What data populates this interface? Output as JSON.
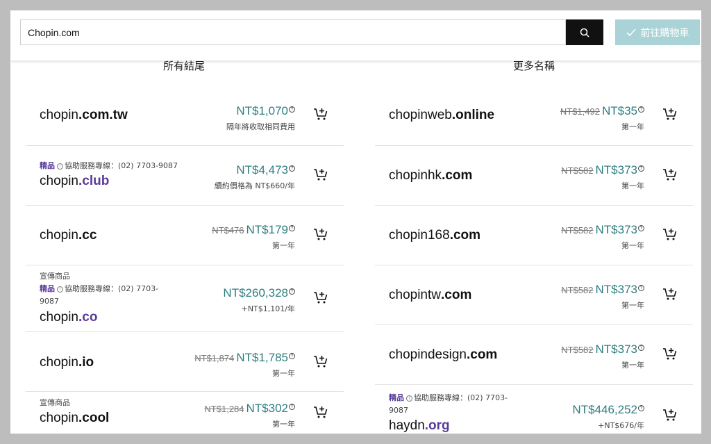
{
  "search": {
    "value": "Chopin.com"
  },
  "cart_button": {
    "label": "前往購物車"
  },
  "columns": {
    "left_title": "所有結尾",
    "right_title": "更多名稱"
  },
  "left": [
    {
      "sld": "chopin",
      "tld": ".com.tw",
      "tld_purple": false,
      "tags": [],
      "old": "",
      "price": "NT$1,070",
      "note": "隔年將收取相同費用"
    },
    {
      "sld": "chopin",
      "tld": ".club",
      "tld_purple": true,
      "promo": "",
      "premium": "精品",
      "service": "協助服務專線：(02) 7703-9087",
      "old": "",
      "price": "NT$4,473",
      "note": "續約價格為 NT$660/年"
    },
    {
      "sld": "chopin",
      "tld": ".cc",
      "tld_purple": false,
      "old": "NT$476",
      "price": "NT$179",
      "note": "第一年"
    },
    {
      "sld": "chopin",
      "tld": ".co",
      "tld_purple": true,
      "promo": "宣傳商品",
      "premium": "精品",
      "service": "協助服務專線：(02) 7703-",
      "service2": "9087",
      "old": "",
      "price": "NT$260,328",
      "note": "+NT$1,101/年"
    },
    {
      "sld": "chopin",
      "tld": ".io",
      "tld_purple": false,
      "old": "NT$1,874",
      "price": "NT$1,785",
      "note": "第一年"
    },
    {
      "sld": "chopin",
      "tld": ".cool",
      "tld_purple": false,
      "promo": "宣傳商品",
      "old": "NT$1,284",
      "price": "NT$302",
      "note": "第一年"
    }
  ],
  "right": [
    {
      "sld": "chopinweb",
      "tld": ".online",
      "old": "NT$1,492",
      "price": "NT$35",
      "note": "第一年"
    },
    {
      "sld": "chopinhk",
      "tld": ".com",
      "old": "NT$582",
      "price": "NT$373",
      "note": "第一年"
    },
    {
      "sld": "chopin168",
      "tld": ".com",
      "old": "NT$582",
      "price": "NT$373",
      "note": "第一年"
    },
    {
      "sld": "chopintw",
      "tld": ".com",
      "old": "NT$582",
      "price": "NT$373",
      "note": "第一年"
    },
    {
      "sld": "chopindesign",
      "tld": ".com",
      "old": "NT$582",
      "price": "NT$373",
      "note": "第一年"
    },
    {
      "sld": "haydn",
      "tld": ".org",
      "tld_purple": true,
      "premium": "精品",
      "service": "協助服務專線：(02) 7703-",
      "service2": "9087",
      "old": "",
      "price": "NT$446,252",
      "note": "+NT$676/年"
    }
  ],
  "icons": {
    "search": "search-icon",
    "check": "check-icon",
    "cart": "add-to-cart-icon",
    "info": "info-icon",
    "question": "question-icon"
  },
  "colors": {
    "accent_teal": "#2d7d7f",
    "premium_purple": "#5a3b9b",
    "cart_button_bg": "#a9d3d6",
    "search_button_bg": "#111111"
  }
}
